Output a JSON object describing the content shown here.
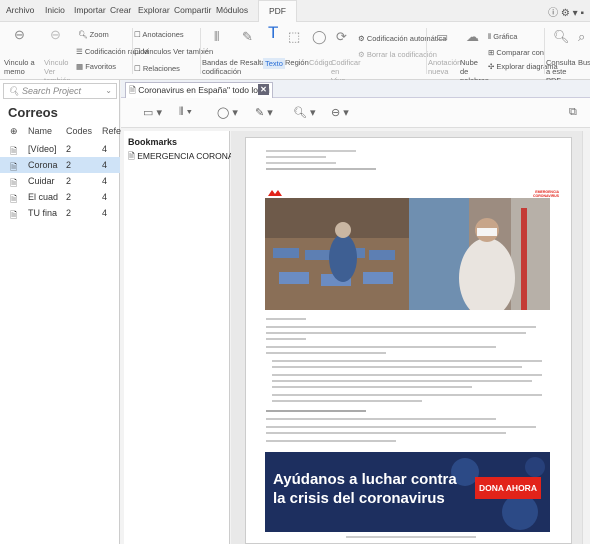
{
  "menu": {
    "tabs": [
      "Archivo",
      "Inicio",
      "Importar",
      "Crear",
      "Explorar",
      "Compartir",
      "Módulos",
      "PDF"
    ],
    "active": "PDF"
  },
  "ribbon": {
    "vinculo_memo": "Vinculo a memo",
    "vinculo_ver_tambien": "Vinculo Ver también",
    "zoom": "Zoom",
    "codificacion_rapida": "Codificación rápida",
    "favoritos": "Favoritos",
    "anotaciones": "Anotaciones",
    "vinculos_ver_tambien": "Vinculos Ver también",
    "relaciones": "Relaciones",
    "bandas": "Bandas de codificación",
    "resaltar": "Resaltar",
    "texto": "Texto",
    "region": "Región",
    "codigo": "Código",
    "codificar_en_vivo": "Codificar en Vivo",
    "codificacion_automatica": "Codificación automática",
    "borrar_codificacion": "Borrar la codificación",
    "anotacion_nueva": "Anotación nueva",
    "nube_palabras": "Nube de palabras",
    "grafica": "Gráfica",
    "comparar_con": "Comparar con",
    "explorar_diagrama": "Explorar diagrama",
    "consulta": "Consulta a este PDF",
    "buscar": "Busc"
  },
  "left_panel": {
    "search_placeholder": "Search Project",
    "title": "Correos",
    "columns": [
      "Name",
      "Codes",
      "Refe"
    ],
    "rows": [
      {
        "name": "[Vídeo]",
        "codes": "2",
        "refs": "4"
      },
      {
        "name": "Corona",
        "codes": "2",
        "refs": "4"
      },
      {
        "name": "Cuidar",
        "codes": "2",
        "refs": "4"
      },
      {
        "name": "El cuad",
        "codes": "2",
        "refs": "4"
      },
      {
        "name": "TU fina",
        "codes": "2",
        "refs": "4"
      }
    ],
    "selected_row": 1
  },
  "document": {
    "tab_title": "Coronavirus en España\" todo lo qu",
    "close_label": "✕",
    "bookmarks_title": "Bookmarks",
    "bookmark_item": "EMERGENCIA CORONA",
    "banner_line1": "Ayúdanos a luchar contra",
    "banner_line2": "la crisis del coronavirus",
    "banner_button": "DONA AHORA",
    "emergencia_label": "EMERGENCIA\nCORONAVIRUS"
  },
  "colors": {
    "accent": "#2a6fd6",
    "selection": "#cfe3f7",
    "banner_bg": "#1d2f5f",
    "msf_red": "#e2231a"
  }
}
